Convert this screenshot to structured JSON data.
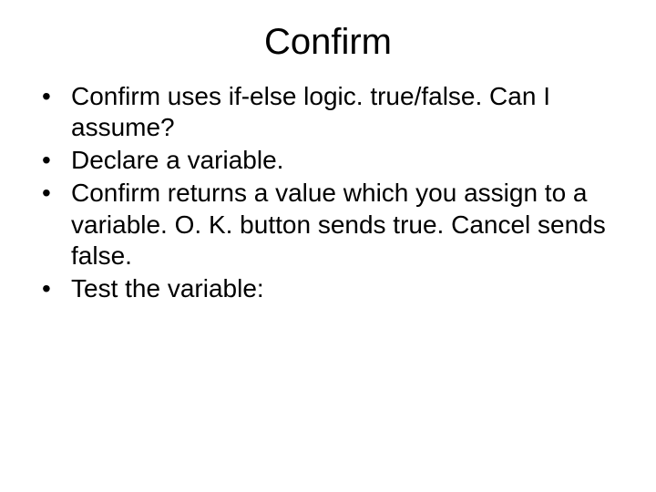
{
  "slide": {
    "title": "Confirm",
    "bullets": [
      "Confirm uses if-else logic. true/false. Can I assume?",
      "Declare a variable.",
      "Confirm returns a value which you assign to a variable.  O. K. button sends true.  Cancel sends false.",
      "Test the variable:"
    ]
  }
}
